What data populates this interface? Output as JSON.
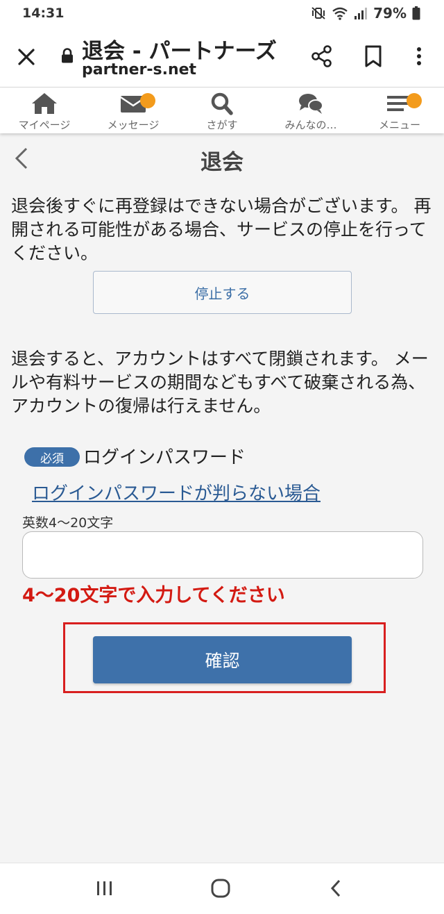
{
  "status_bar": {
    "time": "14:31",
    "battery": "79%",
    "icons": [
      "mute-vibrate-icon",
      "wifi-icon",
      "signal-icon",
      "battery-icon"
    ]
  },
  "browser": {
    "title": "退会 - パートナーズ",
    "host": "partner-s.net",
    "icons": [
      "close-icon",
      "lock-icon",
      "share-icon",
      "bookmark-icon",
      "more-vert-icon"
    ]
  },
  "nav": {
    "items": [
      {
        "label": "マイページ",
        "icon": "home-icon",
        "badge": false
      },
      {
        "label": "メッセージ",
        "icon": "mail-icon",
        "badge": true
      },
      {
        "label": "さがす",
        "icon": "search-icon",
        "badge": false
      },
      {
        "label": "みんなの…",
        "icon": "chat-icon",
        "badge": false
      },
      {
        "label": "メニュー",
        "icon": "menu-icon",
        "badge": true
      }
    ],
    "badge_color": "#f39b1c"
  },
  "page": {
    "title": "退会",
    "notice_1": "退会後すぐに再登録はできない場合がございます。 再開される可能性がある場合、サービスの停止を行ってください。",
    "stop_button": "停止する",
    "notice_2": "退会すると、アカウントはすべて閉鎖されます。 メールや有料サービスの期間などもすべて破棄される為、アカウントの復帰は行えません。",
    "required_badge": "必須",
    "field_label": "ログインパスワード",
    "forgot_link": "ログインパスワードが判らない場合",
    "input_hint": "英数4～20文字",
    "password_value": "",
    "error_message": "4～20文字で入力してください",
    "confirm_button": "確認"
  },
  "colors": {
    "accent_blue": "#3e71aa",
    "error_red": "#d31a12",
    "highlight_red": "#d81f1f"
  }
}
